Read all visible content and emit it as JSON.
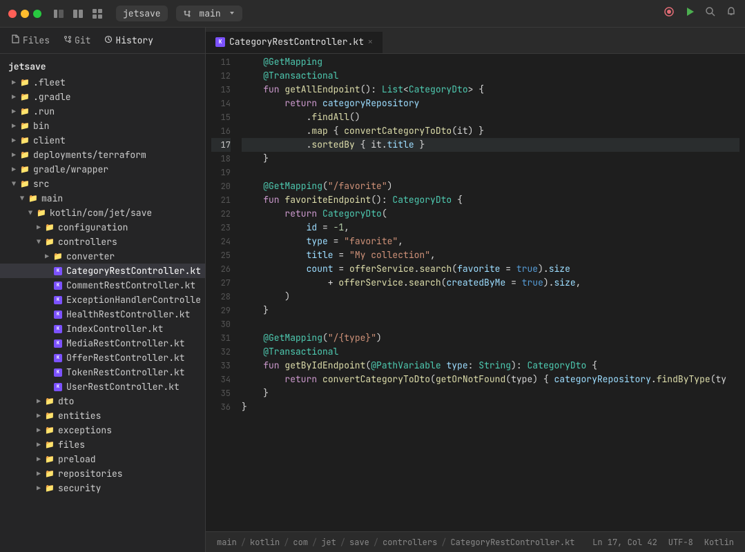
{
  "titlebar": {
    "project": "jetsave",
    "branch": "main",
    "icons": [
      "sidebar-left",
      "diff-editor",
      "layout-grid"
    ],
    "right_icons": [
      "record",
      "run",
      "search",
      "bell"
    ]
  },
  "sidebar": {
    "tabs": [
      {
        "label": "Files",
        "icon": "📄"
      },
      {
        "label": "Git",
        "icon": "⎇"
      },
      {
        "label": "History",
        "icon": "🕒"
      }
    ],
    "active_tab": "Files",
    "root": "jetsave",
    "tree": [
      {
        "label": ".fleet",
        "indent": 0,
        "type": "folder",
        "expanded": false
      },
      {
        "label": ".gradle",
        "indent": 0,
        "type": "folder",
        "expanded": false
      },
      {
        "label": ".run",
        "indent": 0,
        "type": "folder",
        "expanded": false
      },
      {
        "label": "bin",
        "indent": 0,
        "type": "folder",
        "expanded": false
      },
      {
        "label": "client",
        "indent": 0,
        "type": "folder",
        "expanded": false
      },
      {
        "label": "deployments/terraform",
        "indent": 0,
        "type": "folder",
        "expanded": false
      },
      {
        "label": "gradle/wrapper",
        "indent": 0,
        "type": "folder",
        "expanded": false
      },
      {
        "label": "src",
        "indent": 0,
        "type": "folder",
        "expanded": true
      },
      {
        "label": "main",
        "indent": 1,
        "type": "folder",
        "expanded": true
      },
      {
        "label": "kotlin/com/jet/save",
        "indent": 2,
        "type": "folder",
        "expanded": true
      },
      {
        "label": "configuration",
        "indent": 3,
        "type": "folder",
        "expanded": false
      },
      {
        "label": "controllers",
        "indent": 3,
        "type": "folder",
        "expanded": true
      },
      {
        "label": "converter",
        "indent": 4,
        "type": "folder",
        "expanded": false
      },
      {
        "label": "CategoryRestController.kt",
        "indent": 4,
        "type": "kotlin",
        "selected": true
      },
      {
        "label": "CommentRestController.kt",
        "indent": 4,
        "type": "kotlin"
      },
      {
        "label": "ExceptionHandlerControlle",
        "indent": 4,
        "type": "kotlin"
      },
      {
        "label": "HealthRestController.kt",
        "indent": 4,
        "type": "kotlin"
      },
      {
        "label": "IndexController.kt",
        "indent": 4,
        "type": "kotlin"
      },
      {
        "label": "MediaRestController.kt",
        "indent": 4,
        "type": "kotlin"
      },
      {
        "label": "OfferRestController.kt",
        "indent": 4,
        "type": "kotlin"
      },
      {
        "label": "TokenRestController.kt",
        "indent": 4,
        "type": "kotlin"
      },
      {
        "label": "UserRestController.kt",
        "indent": 4,
        "type": "kotlin"
      },
      {
        "label": "dto",
        "indent": 3,
        "type": "folder",
        "expanded": false
      },
      {
        "label": "entities",
        "indent": 3,
        "type": "folder",
        "expanded": false
      },
      {
        "label": "exceptions",
        "indent": 3,
        "type": "folder",
        "expanded": false
      },
      {
        "label": "files",
        "indent": 3,
        "type": "folder",
        "expanded": false
      },
      {
        "label": "preload",
        "indent": 3,
        "type": "folder",
        "expanded": false
      },
      {
        "label": "repositories",
        "indent": 3,
        "type": "folder",
        "expanded": false
      },
      {
        "label": "security",
        "indent": 3,
        "type": "folder",
        "expanded": false
      }
    ]
  },
  "editor": {
    "tab_filename": "CategoryRestController.kt",
    "lines": [
      {
        "num": 11,
        "content": ""
      },
      {
        "num": 12,
        "content": ""
      },
      {
        "num": 13,
        "content": ""
      },
      {
        "num": 14,
        "content": ""
      },
      {
        "num": 15,
        "content": ""
      },
      {
        "num": 16,
        "content": ""
      },
      {
        "num": 17,
        "content": ""
      },
      {
        "num": 18,
        "content": ""
      },
      {
        "num": 19,
        "content": ""
      },
      {
        "num": 20,
        "content": ""
      },
      {
        "num": 21,
        "content": ""
      },
      {
        "num": 22,
        "content": ""
      },
      {
        "num": 23,
        "content": ""
      },
      {
        "num": 24,
        "content": ""
      },
      {
        "num": 25,
        "content": ""
      },
      {
        "num": 26,
        "content": ""
      },
      {
        "num": 27,
        "content": ""
      },
      {
        "num": 28,
        "content": ""
      },
      {
        "num": 29,
        "content": ""
      },
      {
        "num": 30,
        "content": ""
      },
      {
        "num": 31,
        "content": ""
      },
      {
        "num": 32,
        "content": ""
      },
      {
        "num": 33,
        "content": ""
      },
      {
        "num": 34,
        "content": ""
      },
      {
        "num": 35,
        "content": ""
      },
      {
        "num": 36,
        "content": ""
      }
    ]
  },
  "statusbar": {
    "breadcrumb": [
      "main",
      "kotlin",
      "com",
      "jet",
      "save",
      "controllers",
      "CategoryRestController.kt"
    ],
    "position": "Ln 17, Col 42",
    "encoding": "UTF-8",
    "language": "Kotlin"
  }
}
